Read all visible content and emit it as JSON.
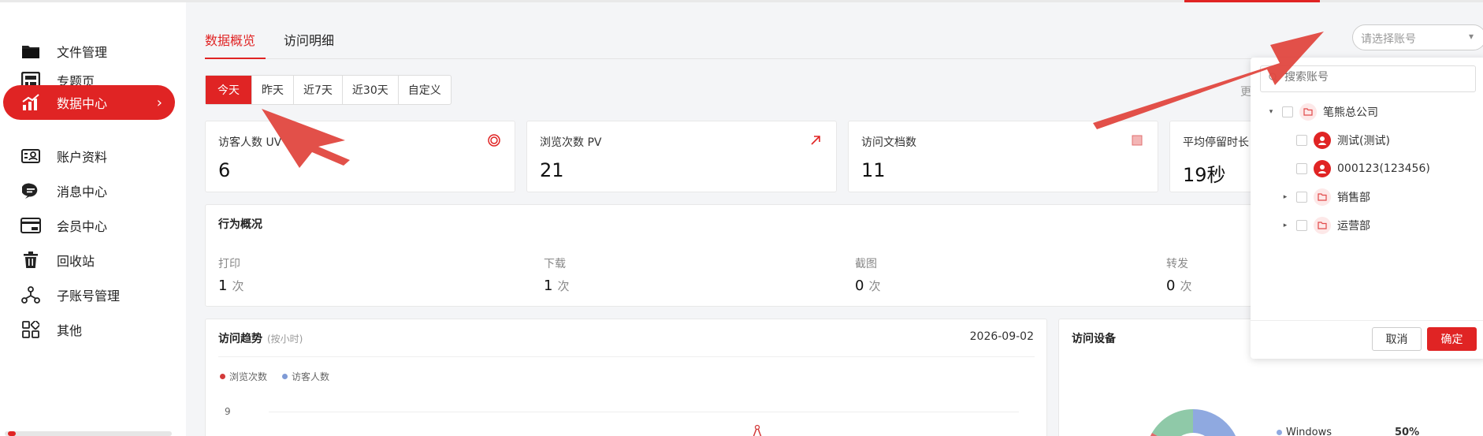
{
  "sidebar": {
    "items": [
      {
        "label": "文件管理",
        "icon": "folder-icon"
      },
      {
        "label": "专题页",
        "icon": "page-layout-icon"
      },
      {
        "label": "数据中心",
        "icon": "data-chart-icon"
      },
      {
        "label": "账户资料",
        "icon": "id-card-icon"
      },
      {
        "label": "消息中心",
        "icon": "message-bubble-icon"
      },
      {
        "label": "会员中心",
        "icon": "vip-card-icon"
      },
      {
        "label": "回收站",
        "icon": "trash-icon"
      },
      {
        "label": "子账号管理",
        "icon": "sub-account-icon"
      },
      {
        "label": "其他",
        "icon": "apps-grid-icon"
      }
    ],
    "active_chevron": "›"
  },
  "tabs": [
    "数据概览",
    "访问明细"
  ],
  "date_filter": {
    "options": [
      "今天",
      "昨天",
      "近7天",
      "近30天",
      "自定义"
    ],
    "selected": "今天"
  },
  "more_label": "更",
  "stats": [
    {
      "title": "访客人数 UV",
      "value": "6",
      "icon": "target-icon"
    },
    {
      "title": "浏览次数 PV",
      "value": "21",
      "icon": "trend-arrow-icon"
    },
    {
      "title": "访问文档数",
      "value": "11",
      "icon": "document-square-icon"
    },
    {
      "title": "平均停留时长",
      "value": "19秒",
      "icon": "clock-icon"
    }
  ],
  "behavior": {
    "title": "行为概况",
    "unit": "次",
    "items": [
      {
        "label": "打印",
        "value": "1"
      },
      {
        "label": "下载",
        "value": "1"
      },
      {
        "label": "截图",
        "value": "0"
      },
      {
        "label": "转发",
        "value": "0"
      }
    ]
  },
  "trend": {
    "title": "访问趋势",
    "subtitle": "(按小时)",
    "date": "2026-09-02",
    "legend": [
      {
        "name": "浏览次数",
        "color": "#d33a3a"
      },
      {
        "name": "访客人数",
        "color": "#7f9bd6"
      }
    ],
    "y_tick": "9"
  },
  "devices": {
    "title": "访问设备",
    "legend": [
      {
        "name": "Windows",
        "percent": "50%",
        "color": "#8fa9e0"
      }
    ],
    "donut_colors": [
      "#8fa9e0",
      "#8fc9a8",
      "#e06a6a"
    ]
  },
  "account_select": {
    "placeholder": "请选择账号",
    "search_placeholder": "搜索账号",
    "tree": [
      {
        "label": "笔熊总公司",
        "level": 0,
        "toggle": "▾",
        "type": "folder"
      },
      {
        "label": "测试(测试)",
        "level": 1,
        "toggle": "",
        "type": "user"
      },
      {
        "label": "000123(123456)",
        "level": 1,
        "toggle": "",
        "type": "user"
      },
      {
        "label": "销售部",
        "level": 1,
        "toggle": "▸",
        "type": "folder"
      },
      {
        "label": "运营部",
        "level": 1,
        "toggle": "▸",
        "type": "folder"
      }
    ],
    "cancel_label": "取消",
    "confirm_label": "确定"
  },
  "colors": {
    "accent": "#e02424",
    "annotation_arrow": "#e0473f"
  }
}
